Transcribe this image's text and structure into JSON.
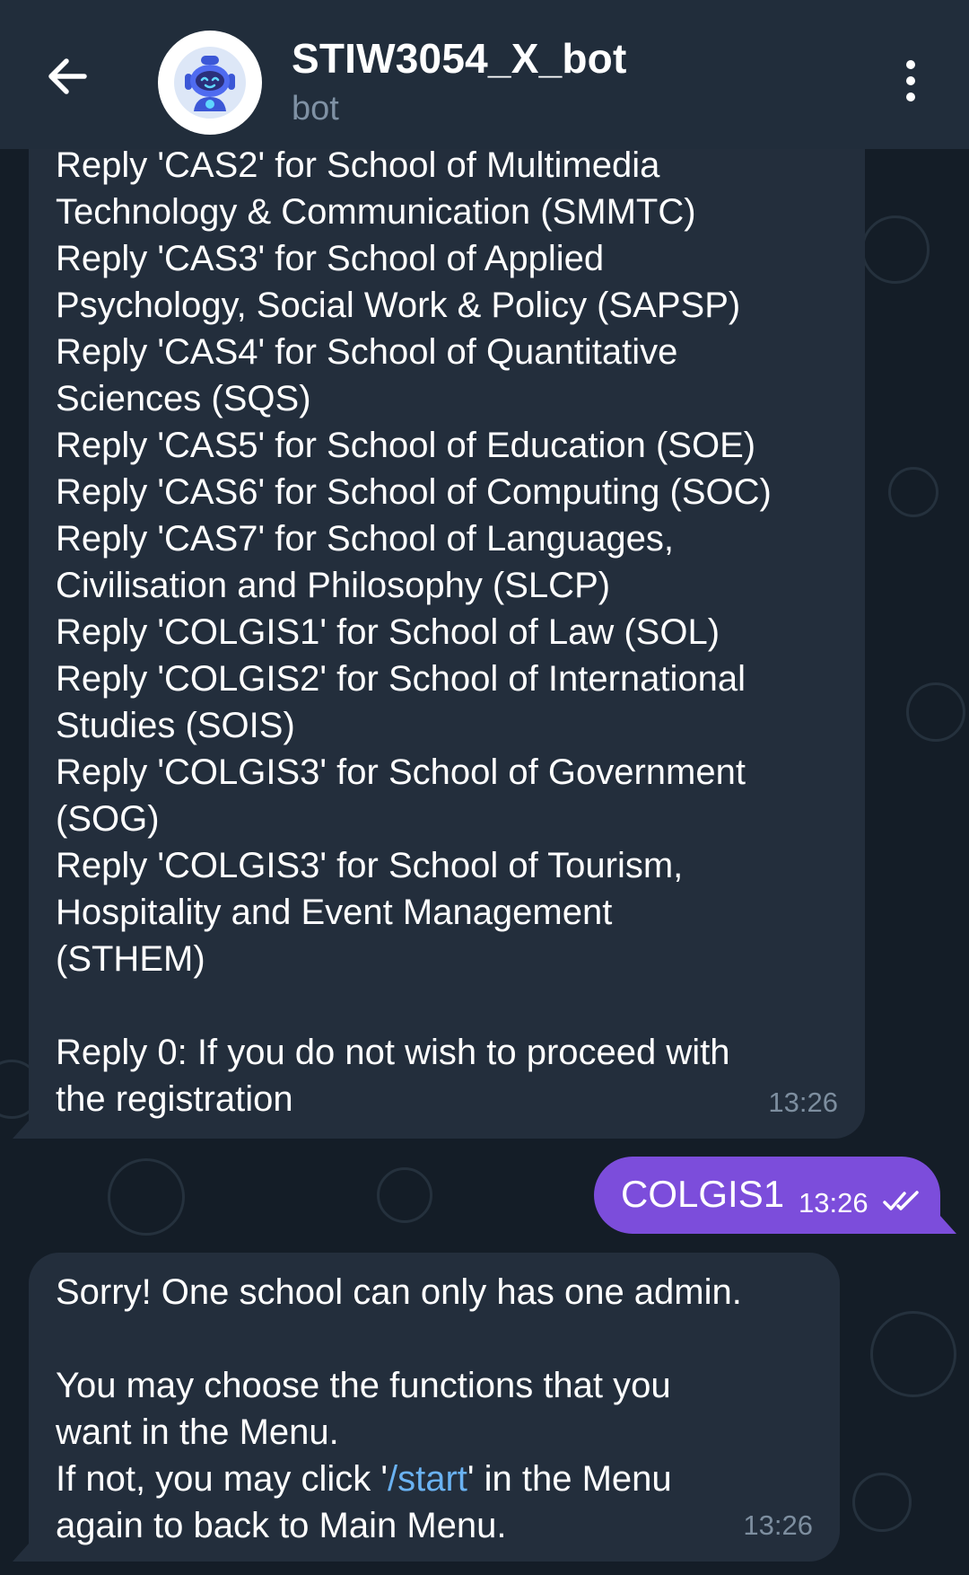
{
  "header": {
    "title": "STIW3054_X_bot",
    "subtitle": "bot"
  },
  "messages": {
    "bot_list": {
      "lines": [
        "Reply 'CAS2' for School of Multimedia",
        "Technology & Communication (SMMTC)",
        "Reply 'CAS3' for School of Applied",
        "Psychology, Social Work & Policy (SAPSP)",
        "Reply 'CAS4' for School of Quantitative",
        "Sciences (SQS)",
        "Reply 'CAS5' for School of Education (SOE)",
        "Reply 'CAS6' for School of Computing (SOC)",
        "Reply 'CAS7' for School of Languages,",
        "Civilisation and Philosophy (SLCP)",
        "Reply 'COLGIS1' for School of Law (SOL)",
        "Reply 'COLGIS2' for School of International",
        "Studies (SOIS)",
        "Reply 'COLGIS3' for School of Government",
        "(SOG)",
        "Reply 'COLGIS3' for School of Tourism,",
        "Hospitality and Event Management",
        "(STHEM)",
        "",
        "Reply 0: If you do not wish to proceed with",
        "the registration"
      ],
      "time": "13:26"
    },
    "user_reply": {
      "text": "COLGIS1",
      "time": "13:26"
    },
    "bot_reply": {
      "line1": "Sorry! One school can only has one admin.",
      "line2": "You may choose the functions that you",
      "line3": "want in the Menu.",
      "line4_pre": "If not, you may click '",
      "line4_link": "/start",
      "line4_post": "' in the Menu",
      "line5": "again to back to Main Menu.",
      "time": "13:26"
    }
  },
  "colors": {
    "header_bg": "#212d3b",
    "bubble_in": "#232e3c",
    "bubble_out": "#7c4ddb",
    "link": "#6ab2f2",
    "muted": "#7f91a4"
  },
  "icons": {
    "back": "arrow-left-icon",
    "menu": "more-vertical-icon",
    "read_status": "double-check-icon"
  }
}
